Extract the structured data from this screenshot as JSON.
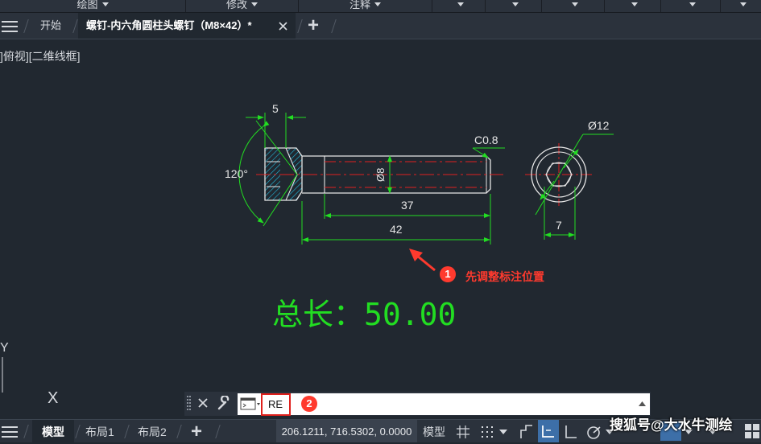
{
  "ribbon": {
    "groups": [
      {
        "label": "绘图",
        "has_caret": true
      },
      {
        "label": "修改",
        "has_caret": true
      },
      {
        "label": "注释",
        "has_caret": true
      }
    ]
  },
  "tabs": {
    "start_label": "开始",
    "document_label": "螺钉-内六角圆柱头螺钉（M8×42）*",
    "close_icon": "close-icon",
    "new_tab_label": "+"
  },
  "viewport": {
    "label": "]俯视][二维线框]"
  },
  "drawing": {
    "dims": {
      "head_width": "5",
      "angle": "120°",
      "diameter": "Ø8",
      "chamfer": "C0.8",
      "thread_length": "37",
      "total_length": "42",
      "head_diameter": "Ø12",
      "hex_size": "7"
    },
    "colors": {
      "dimension": "#22dd22",
      "outline": "#e6e6e6",
      "centerline": "#e02020",
      "hatch": "#22bbdd",
      "annotation": "#ff3a2e"
    }
  },
  "annotations": {
    "step1_number": "1",
    "step1_text": "先调整标注位置",
    "total_length_text": "总长：50.00",
    "step2_number": "2"
  },
  "ucs": {
    "y_label": "Y",
    "x_label": "X"
  },
  "command_line": {
    "typed_text": "RE"
  },
  "status_bar": {
    "tabs": [
      "模型",
      "布局1",
      "布局2"
    ],
    "new_layout_label": "+",
    "coordinates": "206.1211, 716.5302, 0.0000",
    "space_label": "模型"
  },
  "watermark": "搜狐号@大水牛测绘"
}
